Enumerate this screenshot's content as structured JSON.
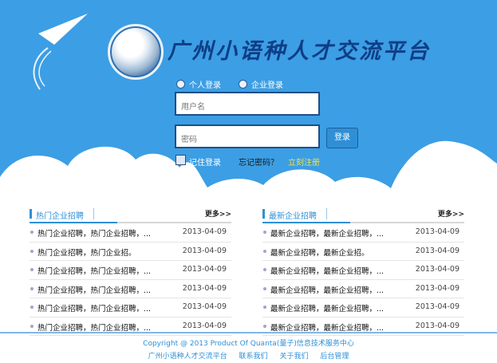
{
  "header": {
    "site_title": "广州小语种人才交流平台"
  },
  "login": {
    "radio_personal": "个人登录",
    "radio_company": "企业登录",
    "username_placeholder": "用户名",
    "password_placeholder": "密码",
    "login_button": "登录",
    "remember_label": "记住登录",
    "forgot_label": "忘记密码？",
    "register_label": "立刻注册"
  },
  "colors": {
    "sky": "#3c9ee4",
    "accent": "#2f8fd6",
    "title": "#0e3e86",
    "register_link": "#f2e24a"
  },
  "panels": {
    "hot": {
      "title": "热门企业招聘",
      "more": "更多>>",
      "rows": [
        {
          "name": "热门企业招聘，热门企业招聘，...",
          "date": "2013-04-09"
        },
        {
          "name": "热门企业招聘，热门企业招。",
          "date": "2013-04-09"
        },
        {
          "name": "热门企业招聘，热门企业招聘，...",
          "date": "2013-04-09"
        },
        {
          "name": "热门企业招聘，热门企业招聘，...",
          "date": "2013-04-09"
        },
        {
          "name": "热门企业招聘，热门企业招聘，...",
          "date": "2013-04-09"
        },
        {
          "name": "热门企业招聘，热门企业招聘，...",
          "date": "2013-04-09"
        }
      ]
    },
    "new": {
      "title": "最新企业招聘",
      "more": "更多>>",
      "rows": [
        {
          "name": "最新企业招聘，最新企业招聘，...",
          "date": "2013-04-09"
        },
        {
          "name": "最新企业招聘，最新企业招。",
          "date": "2013-04-09"
        },
        {
          "name": "最新企业招聘，最新企业招聘，...",
          "date": "2013-04-09"
        },
        {
          "name": "最新企业招聘，最新企业招聘，...",
          "date": "2013-04-09"
        },
        {
          "name": "最新企业招聘，最新企业招聘，...",
          "date": "2013-04-09"
        },
        {
          "name": "最新企业招聘，最新企业招聘，...",
          "date": "2013-04-09"
        }
      ]
    }
  },
  "footer": {
    "copyright": "Copyright @ 2013 Product Of Quanta(量子)信息技术服务中心",
    "links": [
      "广州小语种人才交流平台",
      "联系我们",
      "关于我们",
      "后台管理"
    ]
  }
}
